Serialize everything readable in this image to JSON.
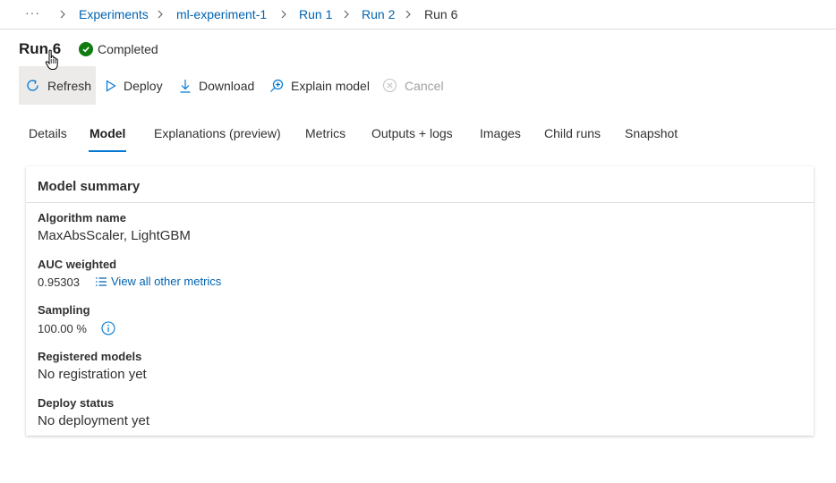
{
  "breadcrumb": {
    "more": "···",
    "items": [
      {
        "label": "Experiments"
      },
      {
        "label": "ml-experiment-1"
      },
      {
        "label": "Run 1"
      },
      {
        "label": "Run 2"
      },
      {
        "label": "Run 6"
      }
    ]
  },
  "header": {
    "title": "Run 6",
    "status": "Completed",
    "status_color": "#107c10"
  },
  "toolbar": {
    "refresh": "Refresh",
    "deploy": "Deploy",
    "download": "Download",
    "explain": "Explain model",
    "cancel": "Cancel"
  },
  "tabs": [
    {
      "label": "Details"
    },
    {
      "label": "Model",
      "active": true
    },
    {
      "label": "Explanations (preview)"
    },
    {
      "label": "Metrics"
    },
    {
      "label": "Outputs + logs"
    },
    {
      "label": "Images"
    },
    {
      "label": "Child runs"
    },
    {
      "label": "Snapshot"
    }
  ],
  "model_summary": {
    "title": "Model summary",
    "algorithm_label": "Algorithm name",
    "algorithm_value": "MaxAbsScaler, LightGBM",
    "auc_label": "AUC weighted",
    "auc_value": "0.95303",
    "metrics_link": "View all other metrics",
    "sampling_label": "Sampling",
    "sampling_value": "100.00 %",
    "registered_label": "Registered models",
    "registered_value": "No registration yet",
    "deploy_label": "Deploy status",
    "deploy_value": "No deployment yet"
  },
  "colors": {
    "accent": "#0078d4",
    "link": "#0063b1",
    "success": "#107c10"
  },
  "icons": [
    "more-icon",
    "chevron-right-icon",
    "check-icon",
    "refresh-icon",
    "play-icon",
    "download-icon",
    "zoom-in-icon",
    "cancel-icon",
    "list-icon",
    "info-icon",
    "hand-cursor-icon"
  ]
}
